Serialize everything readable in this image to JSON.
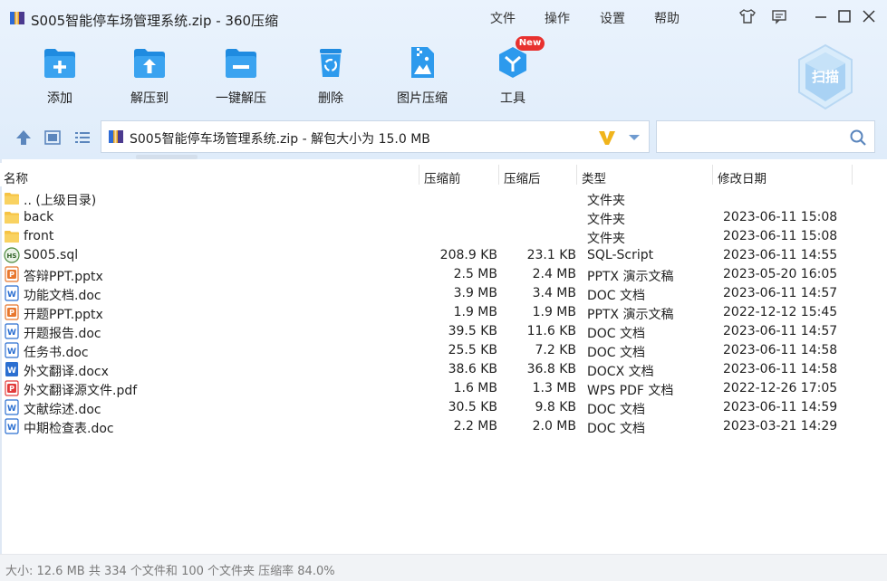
{
  "window": {
    "title": "S005智能停车场管理系统.zip - 360压缩",
    "menu": [
      "文件",
      "操作",
      "设置",
      "帮助"
    ]
  },
  "toolbar": {
    "add": "添加",
    "extract_to": "解压到",
    "one_click_extract": "一键解压",
    "delete": "删除",
    "image_compress": "图片压缩",
    "tools": "工具",
    "new_badge": "New",
    "scan": "扫描"
  },
  "address": {
    "path": "S005智能停车场管理系统.zip - 解包大小为 15.0 MB",
    "search_placeholder": ""
  },
  "columns": {
    "name": "名称",
    "before": "压缩前",
    "after": "压缩后",
    "type": "类型",
    "modified": "修改日期"
  },
  "files": [
    {
      "icon": "folder-icon",
      "name": ".. (上级目录)",
      "before": "",
      "after": "",
      "type": "文件夹",
      "date": ""
    },
    {
      "icon": "folder-icon",
      "name": "back",
      "before": "",
      "after": "",
      "type": "文件夹",
      "date": "2023-06-11 15:08"
    },
    {
      "icon": "folder-icon",
      "name": "front",
      "before": "",
      "after": "",
      "type": "文件夹",
      "date": "2023-06-11 15:08"
    },
    {
      "icon": "sql-file-icon",
      "name": "S005.sql",
      "before": "208.9 KB",
      "after": "23.1 KB",
      "type": "SQL-Script",
      "date": "2023-06-11 14:55"
    },
    {
      "icon": "pptx-file-icon",
      "name": "答辩PPT.pptx",
      "before": "2.5 MB",
      "after": "2.4 MB",
      "type": "PPTX 演示文稿",
      "date": "2023-05-20 16:05"
    },
    {
      "icon": "doc-file-icon",
      "name": "功能文档.doc",
      "before": "3.9 MB",
      "after": "3.4 MB",
      "type": "DOC 文档",
      "date": "2023-06-11 14:57"
    },
    {
      "icon": "pptx-file-icon",
      "name": "开题PPT.pptx",
      "before": "1.9 MB",
      "after": "1.9 MB",
      "type": "PPTX 演示文稿",
      "date": "2022-12-12 15:45"
    },
    {
      "icon": "doc-file-icon",
      "name": "开题报告.doc",
      "before": "39.5 KB",
      "after": "11.6 KB",
      "type": "DOC 文档",
      "date": "2023-06-11 14:57"
    },
    {
      "icon": "doc-file-icon",
      "name": "任务书.doc",
      "before": "25.5 KB",
      "after": "7.2 KB",
      "type": "DOC 文档",
      "date": "2023-06-11 14:58"
    },
    {
      "icon": "docx-file-icon",
      "name": "外文翻译.docx",
      "before": "38.6 KB",
      "after": "36.8 KB",
      "type": "DOCX 文档",
      "date": "2023-06-11 14:58"
    },
    {
      "icon": "pdf-file-icon",
      "name": "外文翻译源文件.pdf",
      "before": "1.6 MB",
      "after": "1.3 MB",
      "type": "WPS PDF 文档",
      "date": "2022-12-26 17:05"
    },
    {
      "icon": "doc-file-icon",
      "name": "文献综述.doc",
      "before": "30.5 KB",
      "after": "9.8 KB",
      "type": "DOC 文档",
      "date": "2023-06-11 14:59"
    },
    {
      "icon": "doc-file-icon",
      "name": "中期检查表.doc",
      "before": "2.2 MB",
      "after": "2.0 MB",
      "type": "DOC 文档",
      "date": "2023-03-21 14:29"
    }
  ],
  "status": {
    "text": "大小: 12.6 MB 共 334 个文件和 100 个文件夹 压缩率 84.0%"
  },
  "colors": {
    "accent": "#1e8fe0",
    "toolbar_bg": "#e6f0fb",
    "folder": "#f6c343",
    "word": "#2b6fd1",
    "ppt": "#e8772e",
    "pdf": "#e23b3b"
  }
}
